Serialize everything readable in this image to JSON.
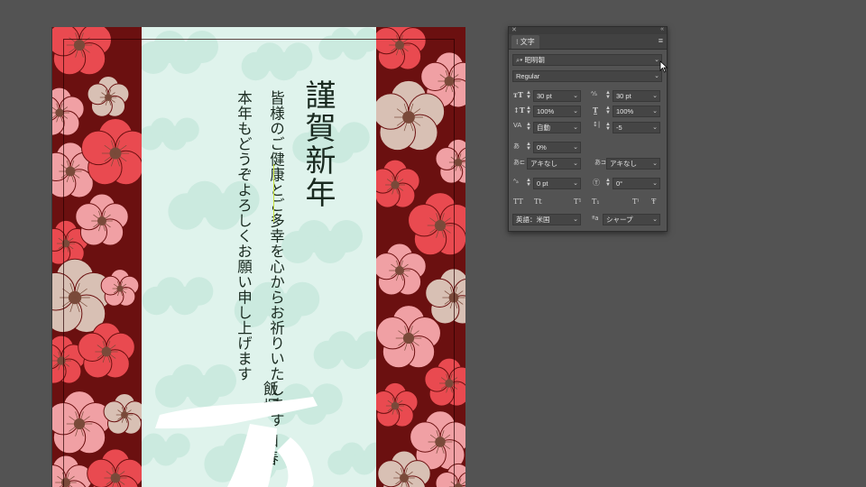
{
  "card": {
    "title": "謹賀新年",
    "message_line1": "皆様のご健康とご多幸を心からお祈りいたします",
    "message_line2": "本年もどうぞよろしくお願い申し上げます",
    "sender_surname": "飯塚",
    "sender_given": "和春"
  },
  "character_panel": {
    "tab_label": "文字",
    "font_family": "昭明朝",
    "font_style": "Regular",
    "font_size": "30 pt",
    "leading": "30 pt",
    "vertical_scale": "100%",
    "horizontal_scale": "100%",
    "kerning": "自動",
    "tracking": "-5",
    "tsume": "0%",
    "aki_left": "アキなし",
    "aki_right": "アキなし",
    "baseline_shift": "0 pt",
    "rotation": "0°",
    "case_buttons": [
      "TT",
      "Tt",
      "T¹",
      "T₁",
      "T⁾",
      "Ŧ"
    ],
    "language": "英語：米国",
    "antialias": "シャープ"
  },
  "colors": {
    "workspace": "#535353",
    "pattern_background": "#6b1010",
    "center_panel": "#dff3ec",
    "blossom_red": "#e94a50",
    "blossom_pink": "#f0a0a4",
    "blossom_beige": "#d8c0b4"
  }
}
